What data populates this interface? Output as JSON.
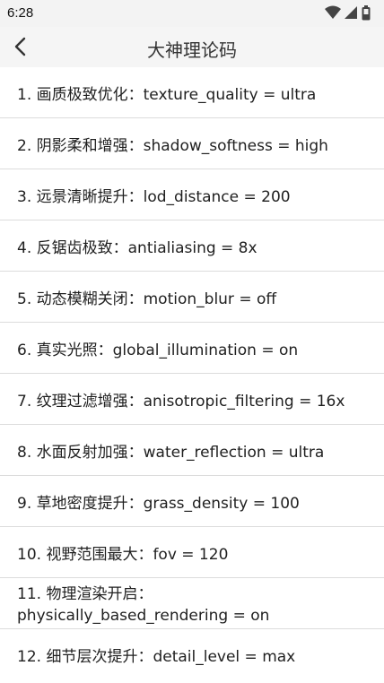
{
  "status_bar": {
    "time": "6:28",
    "icons": [
      "wifi-icon",
      "cellular-signal-icon",
      "battery-icon"
    ]
  },
  "app_bar": {
    "title": "大神理论码",
    "back_icon": "chevron-left-icon"
  },
  "settings": [
    {
      "text": "1. 画质极致优化：texture_quality = ultra"
    },
    {
      "text": "2. 阴影柔和增强：shadow_softness = high"
    },
    {
      "text": "3. 远景清晰提升：lod_distance = 200"
    },
    {
      "text": "4. 反锯齿极致：antialiasing = 8x"
    },
    {
      "text": "5. 动态模糊关闭：motion_blur = off"
    },
    {
      "text": "6. 真实光照：global_illumination = on"
    },
    {
      "text": "7. 纹理过滤增强：anisotropic_filtering = 16x"
    },
    {
      "text": "8. 水面反射加强：water_reflection = ultra"
    },
    {
      "text": "9. 草地密度提升：grass_density = 100"
    },
    {
      "text": "10. 视野范围最大：fov = 120"
    },
    {
      "text": "11. 物理渲染开启：\nphysically_based_rendering = on"
    },
    {
      "text": "12. 细节层次提升：detail_level = max"
    }
  ]
}
